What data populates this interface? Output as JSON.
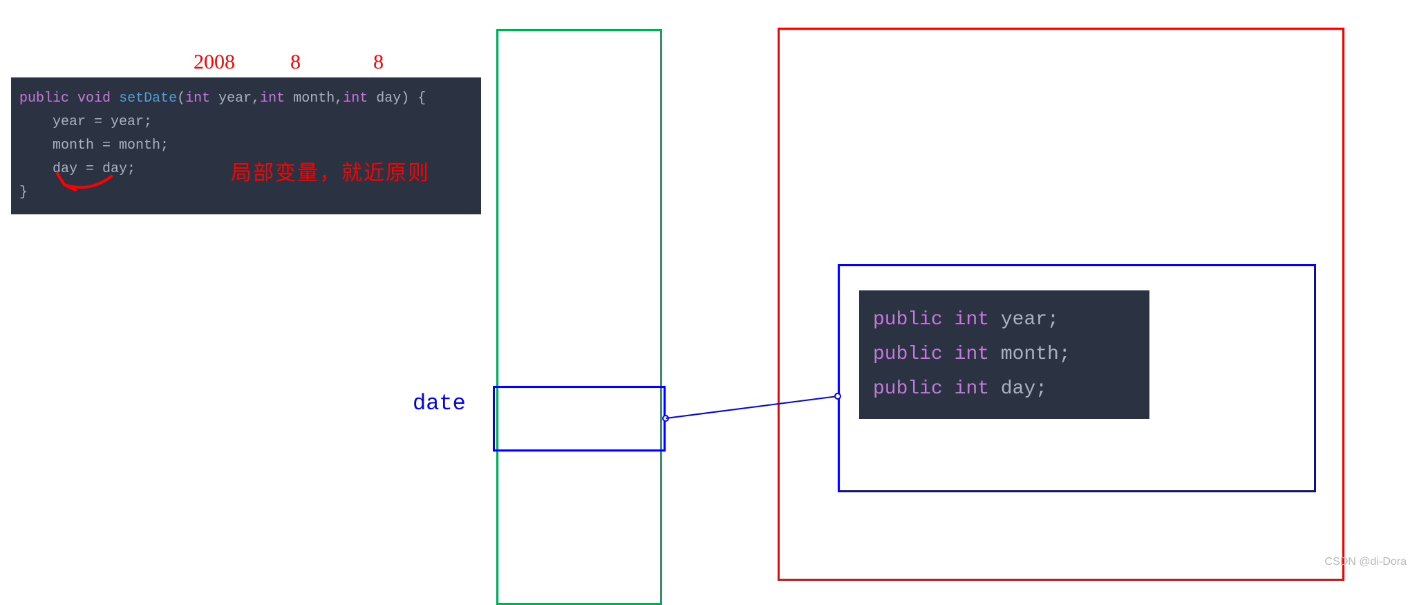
{
  "annotations": {
    "num_year": "2008",
    "num_month": "8",
    "num_day": "8",
    "local_var_principle": "局部变量，就近原则",
    "date_label": "date"
  },
  "code_left": {
    "sig_public": "public",
    "sig_void": "void",
    "sig_fn": "setDate",
    "sig_open": "(",
    "p1_type": "int",
    "p1_name": "year",
    "comma1": ",",
    "p2_type": "int",
    "p2_name": "month",
    "comma2": ",",
    "p3_type": "int",
    "p3_name": "day",
    "sig_close": ") {",
    "l1": "year = year;",
    "l2": "month = month;",
    "l3": "day = day;",
    "l4": "}"
  },
  "code_right": {
    "f1_public": "public",
    "f1_int": "int",
    "f1_name": "year;",
    "f2_public": "public",
    "f2_int": "int",
    "f2_name": "month;",
    "f3_public": "public",
    "f3_int": "int",
    "f3_name": "day;"
  },
  "watermark": "CSDN @di-Dora"
}
